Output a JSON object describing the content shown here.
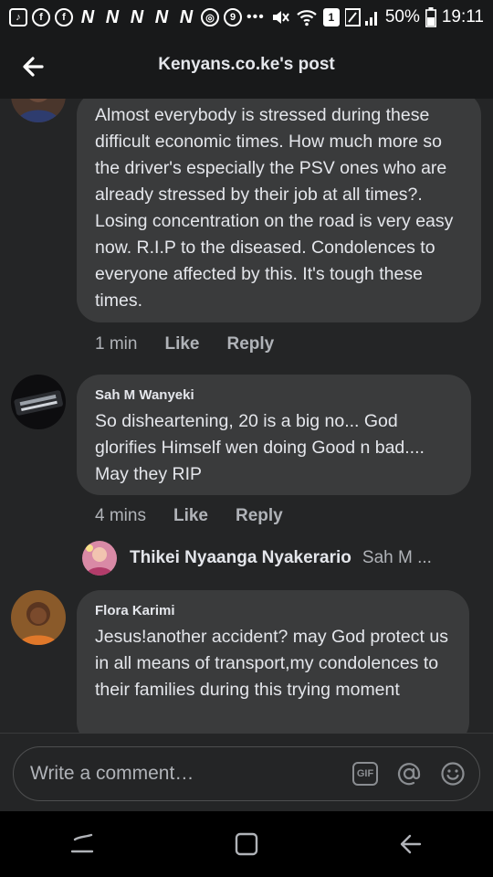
{
  "status_bar": {
    "battery_percent": "50%",
    "time": "19:11",
    "icons": [
      "tiktok-icon",
      "facebook-icon",
      "facebook-icon",
      "nation-icon",
      "nation-icon",
      "nation-icon",
      "nation-icon",
      "nation-icon",
      "chrome-icon",
      "opera-icon",
      "more-icon",
      "mute-icon",
      "wifi-icon",
      "sim-icon",
      "signal-icon",
      "battery-icon"
    ],
    "sim_slot": "1"
  },
  "header": {
    "title": "Kenyans.co.ke's post"
  },
  "comments": [
    {
      "author": "",
      "text": "Almost everybody is stressed during these difficult economic times. How much more so the driver's especially the PSV ones who are already stressed by their job at all times?. Losing concentration on the road is very easy now. R.I.P to the diseased. Condolences to everyone affected by this. It's tough these times.",
      "time": "1 min",
      "like_label": "Like",
      "reply_label": "Reply"
    },
    {
      "author": "Sah M Wanyeki",
      "text": "So  disheartening, 20 is a big no... God glorifies Himself wen doing Good n bad.... May they RIP",
      "time": "4 mins",
      "like_label": "Like",
      "reply_label": "Reply",
      "reply_preview": {
        "name": "Thikei Nyaanga Nyakerario",
        "snippet": "Sah M ..."
      }
    },
    {
      "author": "Flora Karimi",
      "text": "Jesus!another accident? may God protect us  in all means of transport,my condolences to their families during this trying moment"
    }
  ],
  "composer": {
    "placeholder": "Write a comment…",
    "gif_label": "GIF"
  },
  "colors": {
    "background": "#242526",
    "bubble": "#3a3b3c",
    "text": "#e4e6eb",
    "muted": "#b0b3b8"
  }
}
